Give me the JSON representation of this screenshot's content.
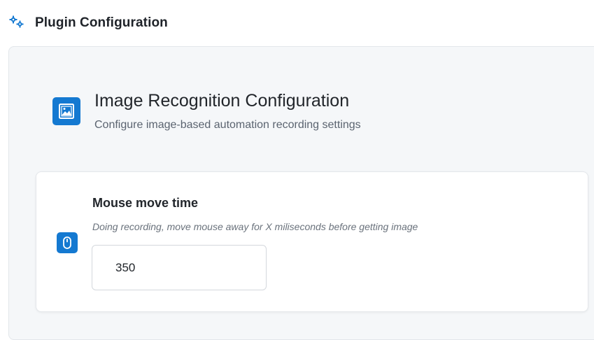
{
  "header": {
    "title": "Plugin Configuration",
    "icon": "gears-icon"
  },
  "section": {
    "title": "Image Recognition Configuration",
    "subtitle": "Configure image-based automation recording settings",
    "icon": "image-frame-icon",
    "icon_color": "#1479d1"
  },
  "field": {
    "label": "Mouse move time",
    "help": "Doing recording, move mouse away for X miliseconds before getting image",
    "value": "350",
    "icon": "mouse-icon",
    "icon_color": "#1479d1"
  },
  "colors": {
    "accent": "#1479d1",
    "panel_bg": "#f5f7f9",
    "card_bg": "#ffffff"
  }
}
